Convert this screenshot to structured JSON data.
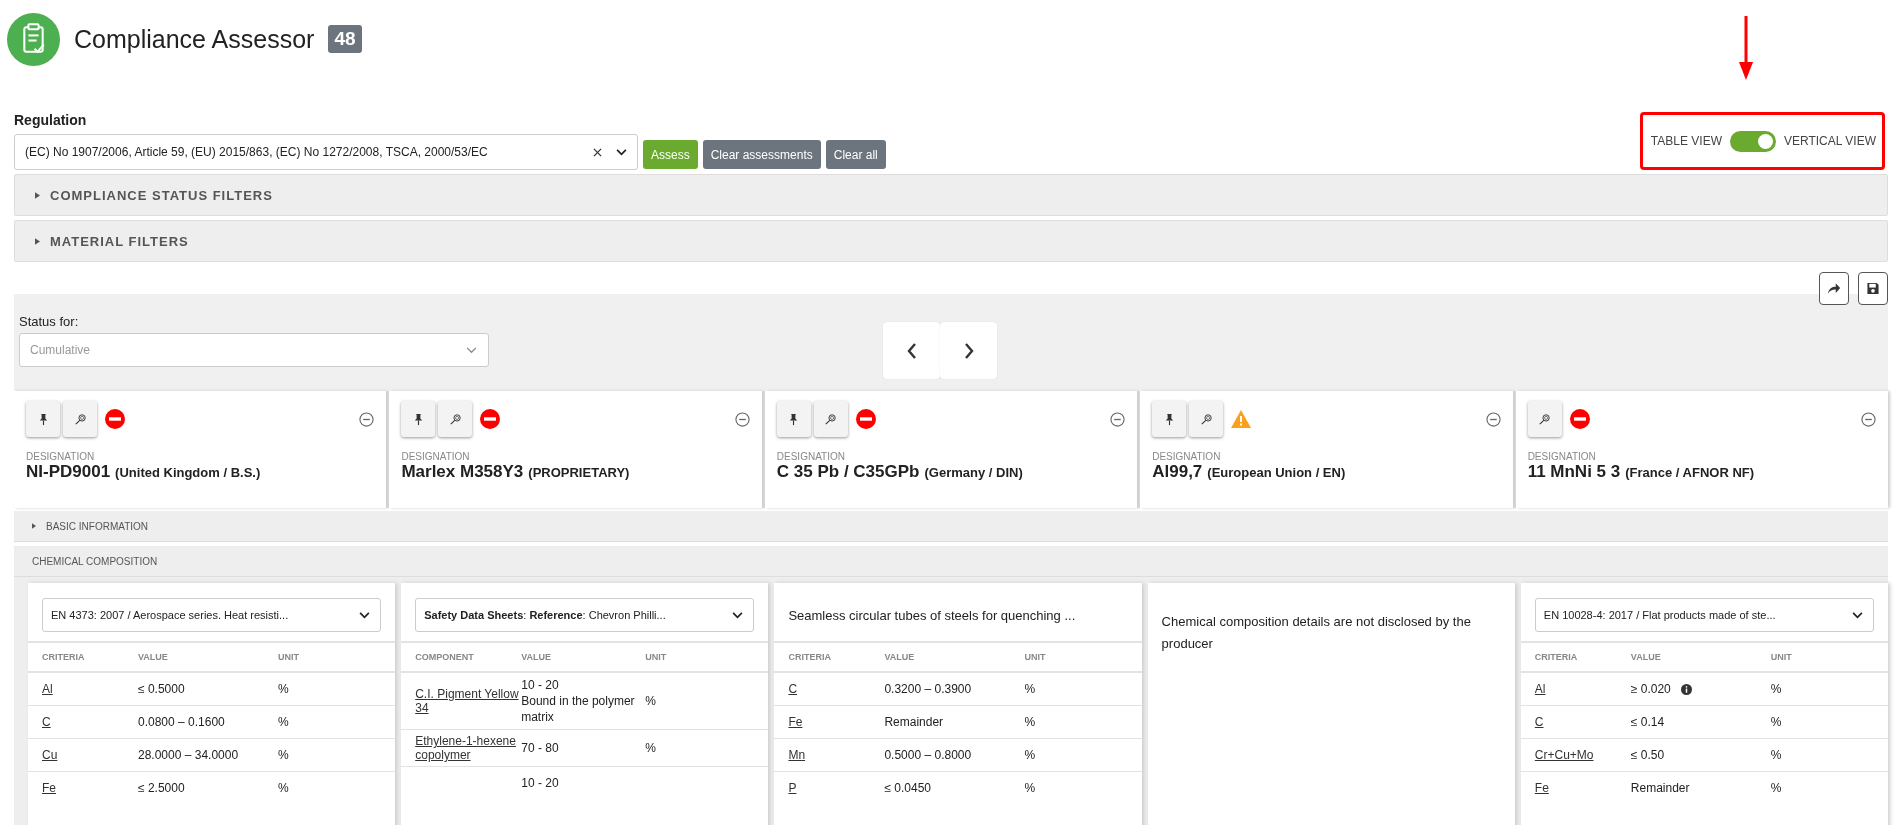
{
  "app": {
    "title": "Compliance Assessor",
    "count": "48"
  },
  "regulation": {
    "label": "Regulation",
    "value": "(EC) No 1907/2006, Article 59, (EU) 2015/863, (EC) No 1272/2008, TSCA, 2000/53/EC",
    "buttons": [
      {
        "label": "Assess",
        "kind": "primary"
      },
      {
        "label": "Clear assessments",
        "kind": "secondary"
      },
      {
        "label": "Clear all",
        "kind": "secondary"
      }
    ]
  },
  "view_toggle": {
    "left_label": "TABLE VIEW",
    "right_label": "VERTICAL VIEW",
    "on": true
  },
  "filter_sections": [
    {
      "title": "COMPLIANCE STATUS FILTERS",
      "expanded": false
    },
    {
      "title": "MATERIAL FILTERS",
      "expanded": false
    }
  ],
  "status_for": {
    "label": "Status for:",
    "placeholder": "Cumulative"
  },
  "materials": [
    {
      "pinnable": true,
      "status": {
        "kind": "noncompliant"
      },
      "designation_label": "DESIGNATION",
      "name": "NI-PD9001",
      "origin": "(United Kingdom / B.S.)"
    },
    {
      "pinnable": true,
      "status": {
        "kind": "noncompliant"
      },
      "designation_label": "DESIGNATION",
      "name": "Marlex M358Y3",
      "origin": "(PROPRIETARY)"
    },
    {
      "pinnable": true,
      "status": {
        "kind": "noncompliant"
      },
      "designation_label": "DESIGNATION",
      "name": "C 35 Pb / C35GPb",
      "origin": "(Germany / DIN)"
    },
    {
      "pinnable": true,
      "status": {
        "kind": "warning"
      },
      "designation_label": "DESIGNATION",
      "name": "Al99,7",
      "origin": "(European Union / EN)"
    },
    {
      "pinnable": false,
      "status": {
        "kind": "noncompliant"
      },
      "designation_label": "DESIGNATION",
      "name": "11 MnNi 5 3",
      "origin": "(France / AFNOR NF)"
    }
  ],
  "sections": [
    {
      "title": "BASIC INFORMATION",
      "expanded": false
    },
    {
      "title": "CHEMICAL COMPOSITION",
      "expanded": true
    }
  ],
  "compositions": [
    {
      "kind": "table",
      "source": {
        "kind": "select",
        "text": "EN 4373: 2007 / Aerospace series. Heat resisti..."
      },
      "columns": [
        "CRITERIA",
        "VALUE",
        "UNIT"
      ],
      "rows": [
        {
          "name": "Al",
          "value": "≤ 0.5000",
          "unit": "%"
        },
        {
          "name": "C",
          "value": "0.0800 – 0.1600",
          "unit": "%"
        },
        {
          "name": "Cu",
          "value": "28.0000 – 34.0000",
          "unit": "%"
        },
        {
          "name": "Fe",
          "value": "≤ 2.5000",
          "unit": "%"
        }
      ]
    },
    {
      "kind": "table",
      "source": {
        "kind": "select",
        "text": "**Safety Data Sheets**: **Reference**: Chevron Philli..."
      },
      "columns": [
        "COMPONENT",
        "VALUE",
        "UNIT"
      ],
      "rows": [
        {
          "name": "C.I. Pigment Yellow 34",
          "value": "10 - 20",
          "note": "Bound in the polymer matrix",
          "unit": "%"
        },
        {
          "name": "Ethylene-1-hexene copolymer",
          "value": "70 - 80",
          "unit": "%"
        },
        {
          "value": "10 - 20"
        }
      ]
    },
    {
      "kind": "table",
      "source": {
        "kind": "heading",
        "text": "Seamless circular tubes of steels for quenching ..."
      },
      "columns": [
        "CRITERIA",
        "VALUE",
        "UNIT"
      ],
      "rows": [
        {
          "name": "C",
          "value": "0.3200 – 0.3900",
          "unit": "%"
        },
        {
          "name": "Fe",
          "value": "Remainder",
          "unit": "%"
        },
        {
          "name": "Mn",
          "value": "0.5000 – 0.8000",
          "unit": "%"
        },
        {
          "name": "P",
          "value": "≤ 0.0450",
          "unit": "%"
        }
      ]
    },
    {
      "kind": "note",
      "text": "Chemical composition details are not disclosed by the producer"
    },
    {
      "kind": "table",
      "source": {
        "kind": "select",
        "text": "EN 10028-4: 2017 / Flat products made of ste..."
      },
      "columns": [
        "CRITERIA",
        "VALUE",
        "UNIT"
      ],
      "rows": [
        {
          "name": "Al",
          "value": "≥ 0.020",
          "info": true,
          "unit": "%"
        },
        {
          "name": "C",
          "value": "≤ 0.14",
          "unit": "%"
        },
        {
          "name": "Cr+Cu+Mo",
          "value": "≤ 0.50",
          "unit": "%"
        },
        {
          "name": "Fe",
          "value": "Remainder",
          "unit": "%"
        }
      ]
    }
  ]
}
